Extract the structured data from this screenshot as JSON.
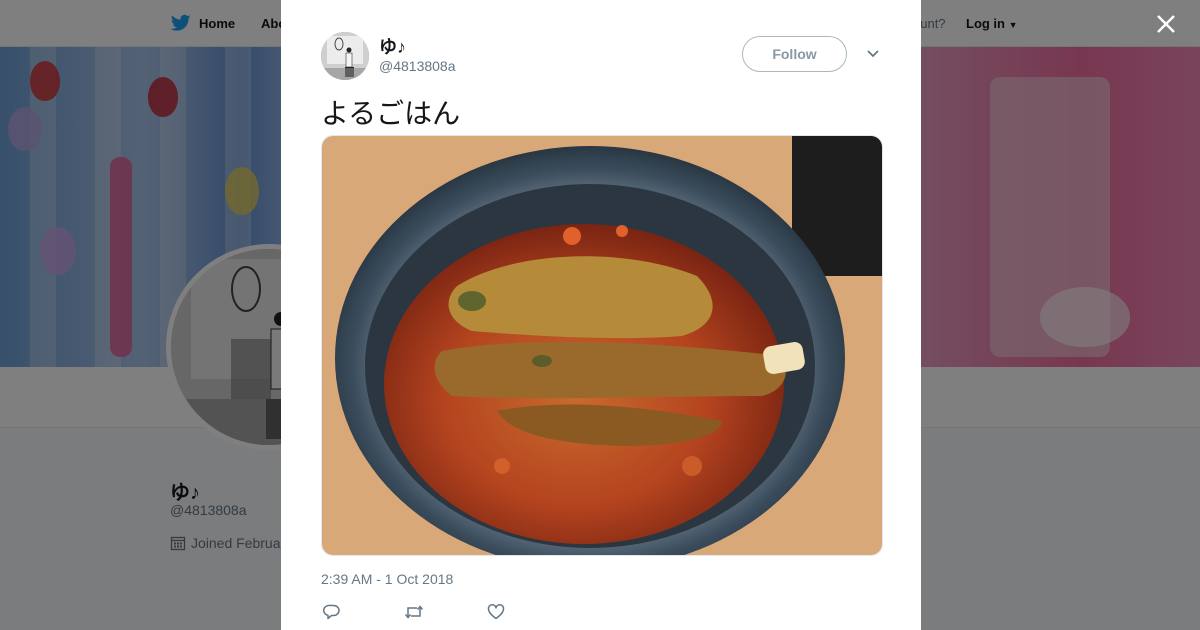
{
  "nav": {
    "home_label": "Home",
    "about_label": "Abo",
    "account_prompt": "ccount?",
    "login_label": "Log in"
  },
  "profile": {
    "name": "ゆ♪",
    "handle": "@4813808a",
    "joined": "Joined Februa"
  },
  "tweet": {
    "author_name": "ゆ♪",
    "author_handle": "@4813808a",
    "follow_label": "Follow",
    "text": "よるごはん",
    "timestamp": "2:39 AM - 1 Oct 2018"
  },
  "icons": {
    "brand": "twitter-bird-icon",
    "close": "close-icon",
    "more": "chevron-down-icon",
    "reply": "reply-icon",
    "retweet": "retweet-icon",
    "like": "heart-icon",
    "calendar": "calendar-icon"
  },
  "colors": {
    "twitter_blue": "#1da1f2",
    "overlay": "rgba(0,0,0,0.5)",
    "secondary_text": "#657786"
  }
}
